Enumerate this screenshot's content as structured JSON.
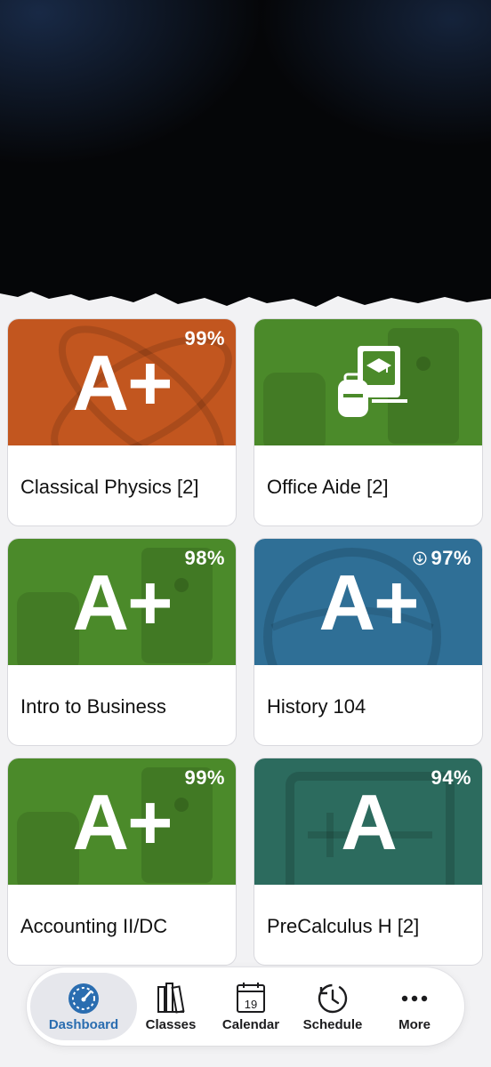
{
  "courses": [
    {
      "grade": "A+",
      "percent": "99%",
      "title": "Classical Physics [2]",
      "color": "#c2561f",
      "trend": false
    },
    {
      "grade": "",
      "percent": "",
      "title": "Office Aide [2]",
      "color": "#4b8a2a",
      "trend": false
    },
    {
      "grade": "A+",
      "percent": "98%",
      "title": "Intro to Business",
      "color": "#4b8a2a",
      "trend": false
    },
    {
      "grade": "A+",
      "percent": "97%",
      "title": "History 104",
      "color": "#2f6f96",
      "trend": true
    },
    {
      "grade": "A+",
      "percent": "99%",
      "title": "Accounting II/DC",
      "color": "#4b8a2a",
      "trend": false
    },
    {
      "grade": "A",
      "percent": "94%",
      "title": "PreCalculus H [2]",
      "color": "#2c6b5e",
      "trend": false
    }
  ],
  "nav": {
    "dashboard": "Dashboard",
    "classes": "Classes",
    "calendar": "Calendar",
    "calendar_day": "19",
    "schedule": "Schedule",
    "more": "More"
  },
  "icons": {
    "trend": "arrow-down-circle-icon",
    "office_aide": "books-backpack-icon"
  },
  "colors": {
    "accent": "#2a6db0"
  }
}
